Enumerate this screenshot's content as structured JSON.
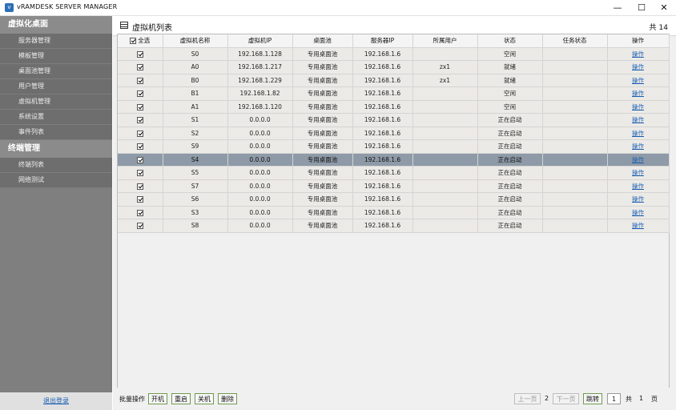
{
  "window": {
    "title": "vRAMDESK SERVER MANAGER",
    "minimize_glyph": "—",
    "maximize_glyph": "☐",
    "close_glyph": "✕"
  },
  "sidebar": {
    "section1": "虚拟化桌面",
    "section1_items": [
      "服务器管理",
      "模板管理",
      "桌面池管理",
      "用户管理",
      "虚拟机管理",
      "系统设置",
      "事件列表"
    ],
    "section2": "终端管理",
    "section2_items": [
      "终端列表",
      "网络测试"
    ],
    "logout": "退出登录"
  },
  "panel": {
    "title": "虚拟机列表",
    "total_prefix": "共",
    "total": "14"
  },
  "table": {
    "select_all": "全选",
    "columns": [
      "虚拟机名称",
      "虚拟机IP",
      "桌面池",
      "服务器IP",
      "所属用户",
      "状态",
      "任务状态",
      "操作"
    ],
    "rows": [
      {
        "name": "S0",
        "ip": "192.168.1.128",
        "pool": "专用桌面池",
        "server": "192.168.1.6",
        "user": "",
        "status": "空闲",
        "task": "",
        "op": "操作",
        "selected": false
      },
      {
        "name": "A0",
        "ip": "192.168.1.217",
        "pool": "专用桌面池",
        "server": "192.168.1.6",
        "user": "zx1",
        "status": "就绪",
        "task": "",
        "op": "操作",
        "selected": false
      },
      {
        "name": "B0",
        "ip": "192.168.1.229",
        "pool": "专用桌面池",
        "server": "192.168.1.6",
        "user": "zx1",
        "status": "就绪",
        "task": "",
        "op": "操作",
        "selected": false
      },
      {
        "name": "B1",
        "ip": "192.168.1.82",
        "pool": "专用桌面池",
        "server": "192.168.1.6",
        "user": "",
        "status": "空闲",
        "task": "",
        "op": "操作",
        "selected": false
      },
      {
        "name": "A1",
        "ip": "192.168.1.120",
        "pool": "专用桌面池",
        "server": "192.168.1.6",
        "user": "",
        "status": "空闲",
        "task": "",
        "op": "操作",
        "selected": false
      },
      {
        "name": "S1",
        "ip": "0.0.0.0",
        "pool": "专用桌面池",
        "server": "192.168.1.6",
        "user": "",
        "status": "正在启动",
        "task": "",
        "op": "操作",
        "selected": false
      },
      {
        "name": "S2",
        "ip": "0.0.0.0",
        "pool": "专用桌面池",
        "server": "192.168.1.6",
        "user": "",
        "status": "正在启动",
        "task": "",
        "op": "操作",
        "selected": false
      },
      {
        "name": "S9",
        "ip": "0.0.0.0",
        "pool": "专用桌面池",
        "server": "192.168.1.6",
        "user": "",
        "status": "正在启动",
        "task": "",
        "op": "操作",
        "selected": false
      },
      {
        "name": "S4",
        "ip": "0.0.0.0",
        "pool": "专用桌面池",
        "server": "192.168.1.6",
        "user": "",
        "status": "正在启动",
        "task": "",
        "op": "操作",
        "selected": true
      },
      {
        "name": "S5",
        "ip": "0.0.0.0",
        "pool": "专用桌面池",
        "server": "192.168.1.6",
        "user": "",
        "status": "正在启动",
        "task": "",
        "op": "操作",
        "selected": false
      },
      {
        "name": "S7",
        "ip": "0.0.0.0",
        "pool": "专用桌面池",
        "server": "192.168.1.6",
        "user": "",
        "status": "正在启动",
        "task": "",
        "op": "操作",
        "selected": false
      },
      {
        "name": "S6",
        "ip": "0.0.0.0",
        "pool": "专用桌面池",
        "server": "192.168.1.6",
        "user": "",
        "status": "正在启动",
        "task": "",
        "op": "操作",
        "selected": false
      },
      {
        "name": "S3",
        "ip": "0.0.0.0",
        "pool": "专用桌面池",
        "server": "192.168.1.6",
        "user": "",
        "status": "正在启动",
        "task": "",
        "op": "操作",
        "selected": false
      },
      {
        "name": "S8",
        "ip": "0.0.0.0",
        "pool": "专用桌面池",
        "server": "192.168.1.6",
        "user": "",
        "status": "正在启动",
        "task": "",
        "op": "操作",
        "selected": false
      }
    ]
  },
  "footer": {
    "batch_label": "批量操作",
    "power_on": "开机",
    "restart": "重启",
    "shutdown": "关机",
    "delete": "删除",
    "prev": "上一页",
    "page_mid": "2",
    "next": "下一页",
    "jump": "跳转",
    "page_input": "1",
    "total_prefix": "共",
    "total_pages": "1",
    "pages_suffix": "页"
  },
  "colors": {
    "sidebar_bg": "#7f7f7f",
    "selected_row": "#8e9aa7",
    "link": "#1a5fb4",
    "button_border": "#6f9a4f"
  }
}
